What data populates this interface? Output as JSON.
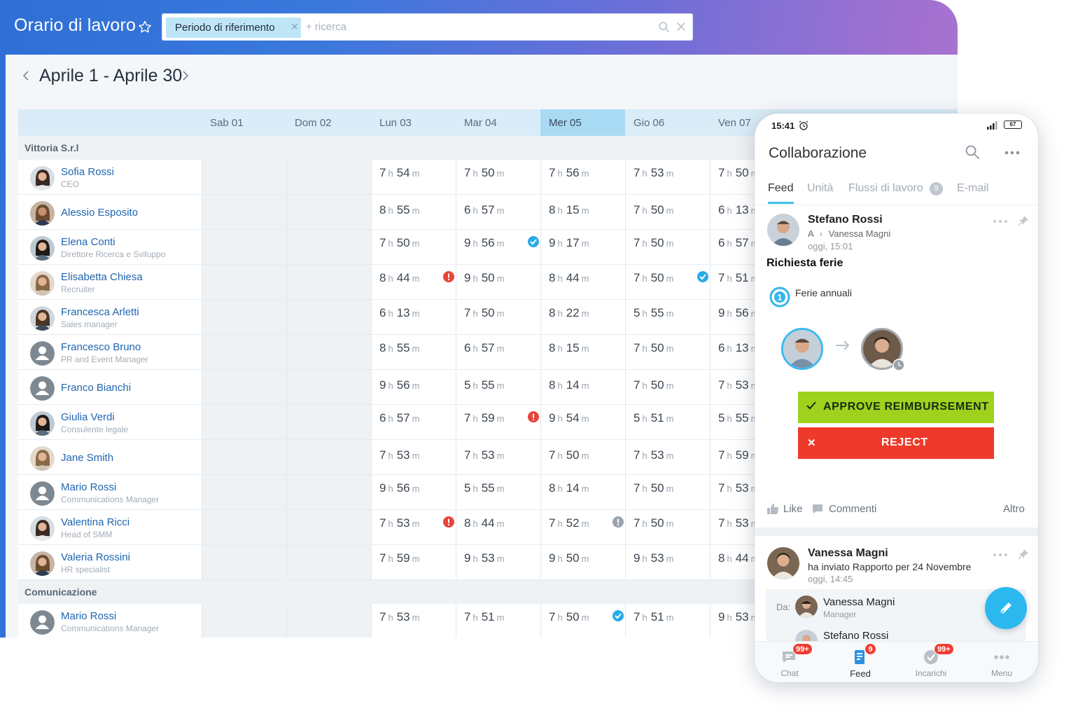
{
  "app": {
    "title": "Orario di lavoro"
  },
  "search": {
    "chip_label": "Periodo di riferimento",
    "placeholder": "+ ricerca"
  },
  "period": {
    "title": "Aprile 1 - Aprile 30"
  },
  "days": [
    "Sab 01",
    "Dom 02",
    "Lun 03",
    "Mar 04",
    "Mer 05",
    "Gio 06",
    "Ven 07"
  ],
  "today_index": 4,
  "groups": [
    {
      "name": "Vittoria S.r.l",
      "employees": [
        {
          "name": "Sofia Rossi",
          "role": "CEO",
          "avatar": "photo-f",
          "hours": [
            "",
            "",
            "7|54",
            "7|50",
            "7|56",
            "7|53",
            "7|50"
          ]
        },
        {
          "name": "Alessio Esposito",
          "role": "",
          "avatar": "photo-m",
          "hours": [
            "",
            "",
            "8|55",
            "6|57",
            "8|15",
            "7|50",
            "6|13"
          ]
        },
        {
          "name": "Elena Conti",
          "role": "Direttore Ricerca e Sviluppo",
          "avatar": "photo-f",
          "hours": [
            "",
            "",
            "7|50",
            "9|56",
            "9|17",
            "7|50",
            "6|57"
          ],
          "marks": {
            "3": "check"
          }
        },
        {
          "name": "Elisabetta Chiesa",
          "role": "Recruiter",
          "avatar": "photo-f",
          "hours": [
            "",
            "",
            "8|44",
            "9|50",
            "8|44",
            "7|50",
            "7|51"
          ],
          "marks": {
            "2": "alert",
            "5": "check"
          }
        },
        {
          "name": "Francesca Arletti",
          "role": "Sales manager",
          "avatar": "photo-f",
          "hours": [
            "",
            "",
            "6|13",
            "7|50",
            "8|22",
            "5|55",
            "9|56"
          ]
        },
        {
          "name": "Francesco Bruno",
          "role": "PR and Event Manager",
          "avatar": "placeholder",
          "hours": [
            "",
            "",
            "8|55",
            "6|57",
            "8|15",
            "7|50",
            "6|13"
          ]
        },
        {
          "name": "Franco Bianchi",
          "role": "",
          "avatar": "placeholder",
          "hours": [
            "",
            "",
            "9|56",
            "5|55",
            "8|14",
            "7|50",
            "7|53"
          ]
        },
        {
          "name": "Giulia Verdi",
          "role": "Consulente legale",
          "avatar": "photo-f",
          "hours": [
            "",
            "",
            "6|57",
            "7|59",
            "9|54",
            "5|51",
            "5|55"
          ],
          "marks": {
            "3": "alert"
          }
        },
        {
          "name": "Jane Smith",
          "role": "",
          "avatar": "photo-f",
          "hours": [
            "",
            "",
            "7|53",
            "7|53",
            "7|50",
            "7|53",
            "7|59"
          ]
        },
        {
          "name": "Mario Rossi",
          "role": "Communications Manager",
          "avatar": "placeholder",
          "hours": [
            "",
            "",
            "9|56",
            "5|55",
            "8|14",
            "7|50",
            "7|53"
          ]
        },
        {
          "name": "Valentina Ricci",
          "role": "Head of SMM",
          "avatar": "photo-f",
          "hours": [
            "",
            "",
            "7|53",
            "8|44",
            "7|52",
            "7|50",
            "7|53"
          ],
          "marks": {
            "2": "alert",
            "4": "info"
          }
        },
        {
          "name": "Valeria Rossini",
          "role": "HR specialist",
          "avatar": "photo-f",
          "hours": [
            "",
            "",
            "7|59",
            "9|53",
            "9|50",
            "9|53",
            "8|44"
          ]
        }
      ]
    },
    {
      "name": "Comunicazione",
      "employees": [
        {
          "name": "Mario Rossi",
          "role": "Communications Manager",
          "avatar": "placeholder",
          "hours": [
            "",
            "",
            "7|53",
            "7|51",
            "7|50",
            "7|51",
            "9|53"
          ],
          "marks": {
            "4": "check"
          }
        }
      ]
    }
  ],
  "units": {
    "h": "h",
    "m": "m"
  },
  "colors": {
    "check": "#2aa9e8",
    "alert": "#e8443a",
    "info": "#9aa4ae",
    "approve": "#9fd21d",
    "reject": "#ee3a2a"
  },
  "phone": {
    "status_time": "15:41",
    "battery": "67",
    "title": "Collaborazione",
    "tabs": [
      "Feed",
      "Unità",
      "Flussi di lavoro",
      "E-mail"
    ],
    "tab_badge": "9",
    "post1": {
      "author": "Stefano Rossi",
      "to_prefix": "A",
      "to_name": "Vanessa Magni",
      "time": "oggi, 15:01",
      "heading": "Richiesta ferie",
      "leave_type": "Ferie annuali",
      "approve_label": "APPROVE REIMBURSEMENT",
      "reject_label": "REJECT",
      "like": "Like",
      "comments": "Commenti",
      "more": "Altro"
    },
    "post2": {
      "author": "Vanessa Magni",
      "text": "ha inviato Rapporto per 24 Novembre",
      "time": "oggi, 14:45",
      "from_label": "Da:",
      "from_name": "Vanessa Magni",
      "from_role": "Manager",
      "to_name": "Stefano Rossi"
    },
    "nav": [
      {
        "label": "Chat",
        "badge": "99+",
        "icon": "chat-icon"
      },
      {
        "label": "Feed",
        "badge": "9",
        "icon": "feed-icon"
      },
      {
        "label": "Incarichi",
        "badge": "99+",
        "icon": "tasks-icon"
      },
      {
        "label": "Menu",
        "badge": "",
        "icon": "menu-icon"
      }
    ]
  }
}
